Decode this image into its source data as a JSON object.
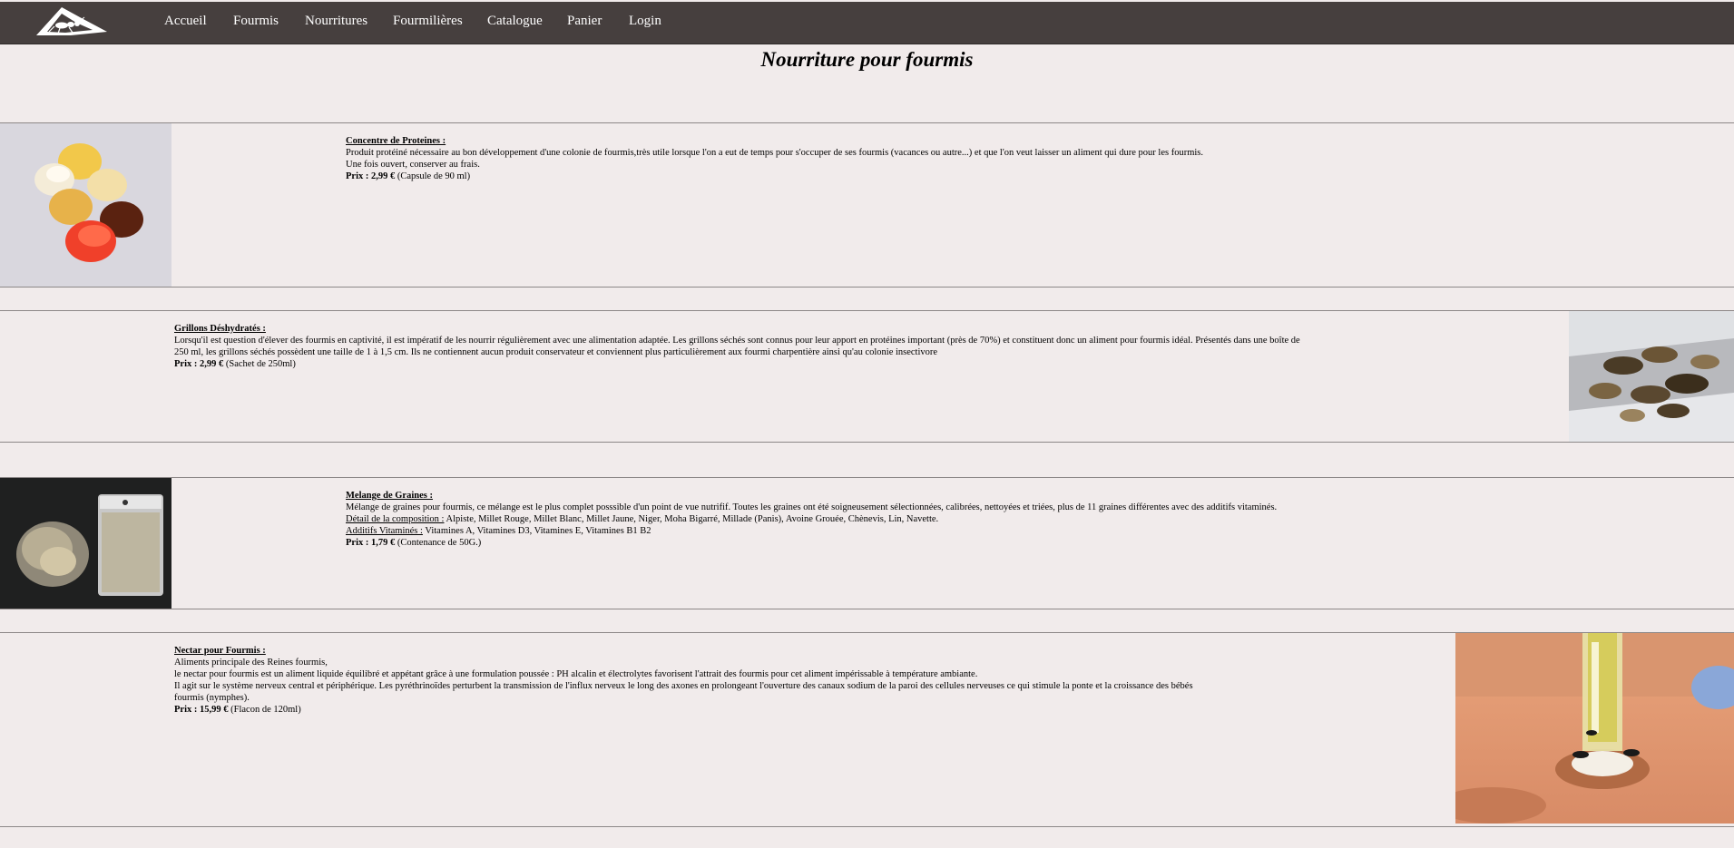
{
  "nav": {
    "logo_name": "ant-logo",
    "items": [
      "Accueil",
      "Fourmis",
      "Nourritures",
      "Fourmilières",
      "Catalogue",
      "Panier",
      "Login"
    ]
  },
  "page": {
    "title": "Nourriture pour fourmis"
  },
  "products": [
    {
      "title": "Concentre de Proteines :",
      "lines": [
        "Produit protéiné nécessaire au bon développement d'une colonie de fourmis,très utile lorsque l'on a eut de temps pour s'occuper de ses fourmis (vacances ou autre...) et que l'on veut laisser un aliment qui dure pour les fourmis.",
        "Une fois ouvert, conserver au frais."
      ],
      "price_label": "Prix : 2,99 €",
      "price_note": " (Capsule de 90 ml)",
      "image": "protein-capsules"
    },
    {
      "title": "Grillons Déshydratés :",
      "lines": [
        "Lorsqu'il est question d'élever des fourmis en captivité, il est impératif de les nourrir régulièrement avec une alimentation adaptée. Les grillons séchés sont connus pour leur apport en protéines important (près de 70%) et constituent donc un aliment pour fourmis idéal. Présentés dans une boîte de",
        "250 ml, les grillons séchés possèdent une taille de 1 à 1,5 cm. Ils ne contiennent aucun produit conservateur et conviennent plus particulièrement aux fourmi charpentière ainsi qu'au colonie insectivore"
      ],
      "price_label": "Prix : 2,99 €",
      "price_note": " (Sachet de 250ml)",
      "image": "dried-crickets"
    },
    {
      "title": "Melange de Graines :",
      "line1": "Mélange de graines pour fourmis, ce mélange est le plus complet posssible d'un point de vue nutrifif. Toutes les graines ont été soigneusement sélectionnées, calibrées, nettoyées et triées, plus de 11 graines différentes avec des additifs vitaminés.",
      "comp_label": "Détail de la composition :",
      "comp_text": " Alpiste, Millet Rouge, Millet Blanc, Millet Jaune, Niger, Moha Bigarré, Millade (Panis), Avoine Grouée, Chènevis, Lin, Navette.",
      "vit_label": "Additifs Vitaminés :",
      "vit_text": " Vitamines A, Vitamines D3, Vitamines E, Vitamines B1 B2",
      "price_label": "Prix : 1,79 €",
      "price_note": " (Contenance de 50G.)",
      "image": "seed-mix"
    },
    {
      "title": "Nectar pour Fourmis :",
      "lines": [
        "Aliments principale des Reines fourmis,",
        "le nectar pour fourmis est un aliment liquide équilibré et appétant grâce à une formulation poussée : PH alcalin et électrolytes favorisent l'attrait des fourmis pour cet aliment impérissable à température ambiante.",
        "Il agit sur le système nerveux central et périphérique. Les pyréthrinoïdes perturbent la transmission de l'influx nerveux le long des axones en prolongeant l'ouverture des canaux sodium de la paroi des cellules nerveuses ce qui stimule la ponte et la croissance des bébés",
        "fourmis (nymphes)."
      ],
      "price_label": "Prix : 15,99 €",
      "price_note": " (Flacon de 120ml)",
      "image": "nectar-feeder"
    }
  ],
  "colors": {
    "background": "#f1ebeb",
    "navbar": "#463f3e",
    "nav_text": "#ffffff",
    "divider": "#8c8787"
  }
}
